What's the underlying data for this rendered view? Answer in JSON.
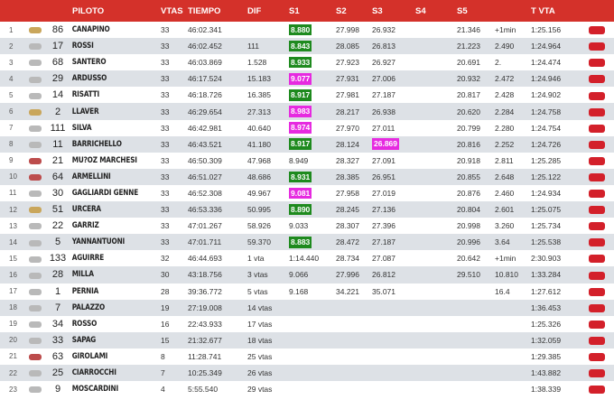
{
  "headers": [
    "",
    "",
    "PILOTO",
    "VTAS",
    "TIEMPO",
    "DIF",
    "S1",
    "S2",
    "S3",
    "S4",
    "S5",
    "",
    "T VTA",
    ""
  ],
  "rows": [
    {
      "pos": "1",
      "brand": "yamaha",
      "num": "86",
      "name": "CANAPINO",
      "vtas": "33",
      "tiempo": "46:02.341",
      "dif": "",
      "s1": "8.880",
      "s1c": "green",
      "s2": "27.998",
      "s3": "26.932",
      "s3c": "",
      "s5": "21.346",
      "gap": "+1min",
      "tvta": "1:25.156"
    },
    {
      "pos": "2",
      "brand": "kawasaki",
      "num": "17",
      "name": "ROSSI",
      "vtas": "33",
      "tiempo": "46:02.452",
      "dif": "111",
      "s1": "8.843",
      "s1c": "green",
      "s2": "28.085",
      "s3": "26.813",
      "s3c": "",
      "s5": "21.223",
      "gap": "2.490",
      "tvta": "1:24.964"
    },
    {
      "pos": "3",
      "brand": "kawasaki",
      "num": "68",
      "name": "SANTERO",
      "vtas": "33",
      "tiempo": "46:03.869",
      "dif": "1.528",
      "s1": "8.933",
      "s1c": "green",
      "s2": "27.923",
      "s3": "26.927",
      "s3c": "",
      "s5": "20.691",
      "gap": "2.",
      "tvta": "1:24.474"
    },
    {
      "pos": "4",
      "brand": "kawasaki",
      "num": "29",
      "name": "ARDUSSO",
      "vtas": "33",
      "tiempo": "46:17.524",
      "dif": "15.183",
      "s1": "9.077",
      "s1c": "pink",
      "s2": "27.931",
      "s3": "27.006",
      "s3c": "",
      "s5": "20.932",
      "gap": "2.472",
      "tvta": "1:24.946"
    },
    {
      "pos": "5",
      "brand": "kawasaki",
      "num": "14",
      "name": "RISATTI",
      "vtas": "33",
      "tiempo": "46:18.726",
      "dif": "16.385",
      "s1": "8.917",
      "s1c": "green",
      "s2": "27.981",
      "s3": "27.187",
      "s3c": "",
      "s5": "20.817",
      "gap": "2.428",
      "tvta": "1:24.902"
    },
    {
      "pos": "6",
      "brand": "yamaha",
      "num": "2",
      "name": "LLAVER",
      "vtas": "33",
      "tiempo": "46:29.654",
      "dif": "27.313",
      "s1": "8.983",
      "s1c": "pink",
      "s2": "28.217",
      "s3": "26.938",
      "s3c": "",
      "s5": "20.620",
      "gap": "2.284",
      "tvta": "1:24.758"
    },
    {
      "pos": "7",
      "brand": "kawasaki",
      "num": "111",
      "name": "SILVA",
      "vtas": "33",
      "tiempo": "46:42.981",
      "dif": "40.640",
      "s1": "8.974",
      "s1c": "pink",
      "s2": "27.970",
      "s3": "27.011",
      "s3c": "",
      "s5": "20.799",
      "gap": "2.280",
      "tvta": "1:24.754"
    },
    {
      "pos": "8",
      "brand": "kawasaki",
      "num": "11",
      "name": "BARRICHELLO",
      "vtas": "33",
      "tiempo": "46:43.521",
      "dif": "41.180",
      "s1": "8.917",
      "s1c": "green",
      "s2": "28.124",
      "s3": "26.869",
      "s3c": "pink",
      "s5": "20.816",
      "gap": "2.252",
      "tvta": "1:24.726"
    },
    {
      "pos": "9",
      "brand": "ducati",
      "num": "21",
      "name": "MU?OZ MARCHESI",
      "vtas": "33",
      "tiempo": "46:50.309",
      "dif": "47.968",
      "s1": "8.949",
      "s1c": "",
      "s2": "28.327",
      "s3": "27.091",
      "s3c": "",
      "s5": "20.918",
      "gap": "2.811",
      "tvta": "1:25.285"
    },
    {
      "pos": "10",
      "brand": "ducati",
      "num": "64",
      "name": "ARMELLINI",
      "vtas": "33",
      "tiempo": "46:51.027",
      "dif": "48.686",
      "s1": "8.931",
      "s1c": "green",
      "s2": "28.385",
      "s3": "26.951",
      "s3c": "",
      "s5": "20.855",
      "gap": "2.648",
      "tvta": "1:25.122"
    },
    {
      "pos": "11",
      "brand": "kawasaki",
      "num": "30",
      "name": "GAGLIARDI GENNE",
      "vtas": "33",
      "tiempo": "46:52.308",
      "dif": "49.967",
      "s1": "9.081",
      "s1c": "pink",
      "s2": "27.958",
      "s3": "27.019",
      "s3c": "",
      "s5": "20.876",
      "gap": "2.460",
      "tvta": "1:24.934"
    },
    {
      "pos": "12",
      "brand": "yamaha",
      "num": "51",
      "name": "URCERA",
      "vtas": "33",
      "tiempo": "46:53.336",
      "dif": "50.995",
      "s1": "8.890",
      "s1c": "green",
      "s2": "28.245",
      "s3": "27.136",
      "s3c": "",
      "s5": "20.804",
      "gap": "2.601",
      "tvta": "1:25.075"
    },
    {
      "pos": "13",
      "brand": "kawasaki",
      "num": "22",
      "name": "GARRIZ",
      "vtas": "33",
      "tiempo": "47:01.267",
      "dif": "58.926",
      "s1": "9.033",
      "s1c": "",
      "s2": "28.307",
      "s3": "27.396",
      "s3c": "",
      "s5": "20.998",
      "gap": "3.260",
      "tvta": "1:25.734"
    },
    {
      "pos": "14",
      "brand": "kawasaki",
      "num": "5",
      "name": "YANNANTUONI",
      "vtas": "33",
      "tiempo": "47:01.711",
      "dif": "59.370",
      "s1": "8.883",
      "s1c": "green",
      "s2": "28.472",
      "s3": "27.187",
      "s3c": "",
      "s5": "20.996",
      "gap": "3.64",
      "tvta": "1:25.538"
    },
    {
      "pos": "15",
      "brand": "kawasaki",
      "num": "133",
      "name": "AGUIRRE",
      "vtas": "32",
      "tiempo": "46:44.693",
      "dif": "1 vta",
      "s1": "1:14.440",
      "s1c": "",
      "s2": "28.734",
      "s3": "27.087",
      "s3c": "",
      "s5": "20.642",
      "gap": "+1min",
      "tvta": "2:30.903"
    },
    {
      "pos": "16",
      "brand": "kawasaki",
      "num": "28",
      "name": "MILLA",
      "vtas": "30",
      "tiempo": "43:18.756",
      "dif": "3 vtas",
      "s1": "9.066",
      "s1c": "",
      "s2": "27.996",
      "s3": "26.812",
      "s3c": "",
      "s5": "29.510",
      "gap": "10.810",
      "tvta": "1:33.284"
    },
    {
      "pos": "17",
      "brand": "kawasaki",
      "num": "1",
      "name": "PERNIA",
      "vtas": "28",
      "tiempo": "39:36.772",
      "dif": "5 vtas",
      "s1": "9.168",
      "s1c": "",
      "s2": "34.221",
      "s3": "35.071",
      "s3c": "",
      "s5": "",
      "gap": "16.4",
      "tvta": "1:27.612"
    },
    {
      "pos": "18",
      "brand": "kawasaki",
      "num": "7",
      "name": "PALAZZO",
      "vtas": "19",
      "tiempo": "27:19.008",
      "dif": "14 vtas",
      "s1": "",
      "s1c": "",
      "s2": "",
      "s3": "",
      "s3c": "",
      "s5": "",
      "gap": "",
      "tvta": "1:36.453"
    },
    {
      "pos": "19",
      "brand": "kawasaki",
      "num": "34",
      "name": "ROSSO",
      "vtas": "16",
      "tiempo": "22:43.933",
      "dif": "17 vtas",
      "s1": "",
      "s1c": "",
      "s2": "",
      "s3": "",
      "s3c": "",
      "s5": "",
      "gap": "",
      "tvta": "1:25.326"
    },
    {
      "pos": "20",
      "brand": "kawasaki",
      "num": "33",
      "name": "SAPAG",
      "vtas": "15",
      "tiempo": "21:32.677",
      "dif": "18 vtas",
      "s1": "",
      "s1c": "",
      "s2": "",
      "s3": "",
      "s3c": "",
      "s5": "",
      "gap": "",
      "tvta": "1:32.059"
    },
    {
      "pos": "21",
      "brand": "ducati",
      "num": "63",
      "name": "GIROLAMI",
      "vtas": "8",
      "tiempo": "11:28.741",
      "dif": "25 vtas",
      "s1": "",
      "s1c": "",
      "s2": "",
      "s3": "",
      "s3c": "",
      "s5": "",
      "gap": "",
      "tvta": "1:29.385"
    },
    {
      "pos": "22",
      "brand": "kawasaki",
      "num": "25",
      "name": "CIARROCCHI",
      "vtas": "7",
      "tiempo": "10:25.349",
      "dif": "26 vtas",
      "s1": "",
      "s1c": "",
      "s2": "",
      "s3": "",
      "s3c": "",
      "s5": "",
      "gap": "",
      "tvta": "1:43.882"
    },
    {
      "pos": "23",
      "brand": "kawasaki",
      "num": "9",
      "name": "MOSCARDINI",
      "vtas": "4",
      "tiempo": "5:55.540",
      "dif": "29 vtas",
      "s1": "",
      "s1c": "",
      "s2": "",
      "s3": "",
      "s3c": "",
      "s5": "",
      "gap": "",
      "tvta": "1:38.339"
    }
  ],
  "colors": {
    "header_bg": "#d4312a",
    "row_alt": "#dde1e6",
    "best_sector": "#1e8a1e",
    "personal_sector": "#e62ae0",
    "action_button": "#d3202a"
  },
  "icons": {
    "brand_logo": "motorcycle-brand-logo-icon",
    "row_action": "red-action-button"
  }
}
